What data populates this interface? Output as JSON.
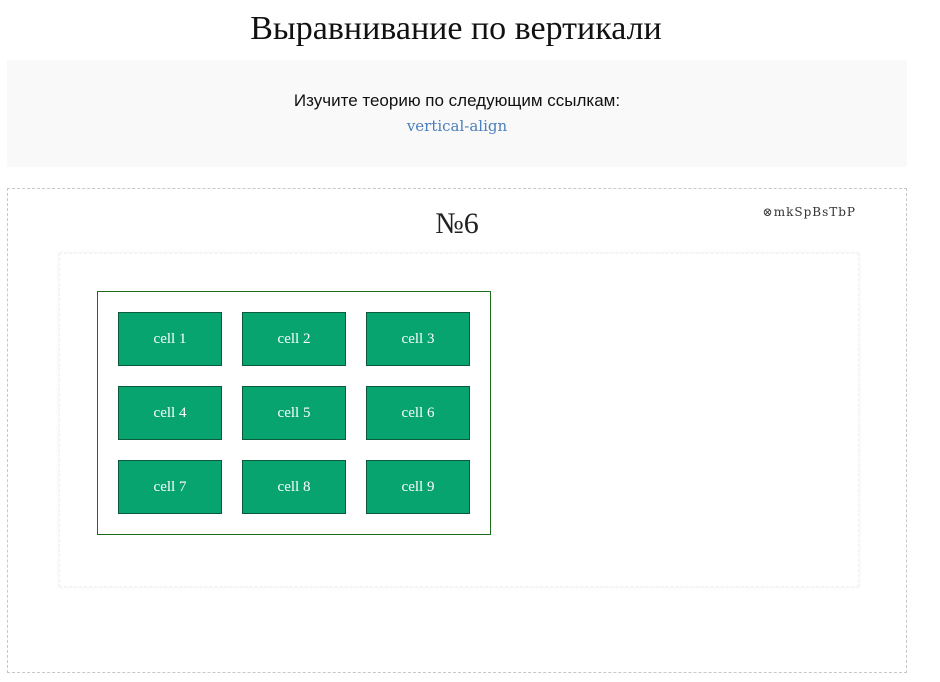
{
  "header": {
    "title": "Выравнивание по вертикали"
  },
  "theory": {
    "text": "Изучите теорию по следующим ссылкам:",
    "link_label": "vertical-align"
  },
  "task": {
    "id": "⊗mkSpBsTbP",
    "number": "№6",
    "cells": [
      {
        "label": "cell 1"
      },
      {
        "label": "cell 2"
      },
      {
        "label": "cell 3"
      },
      {
        "label": "cell 4"
      },
      {
        "label": "cell 5"
      },
      {
        "label": "cell 6"
      },
      {
        "label": "cell 7"
      },
      {
        "label": "cell 8"
      },
      {
        "label": "cell 9"
      }
    ]
  },
  "colors": {
    "cell_background": "#07a46f",
    "cell_border": "#0b5a3a",
    "container_border": "#1d6b1d",
    "link": "#4a7fbb"
  }
}
